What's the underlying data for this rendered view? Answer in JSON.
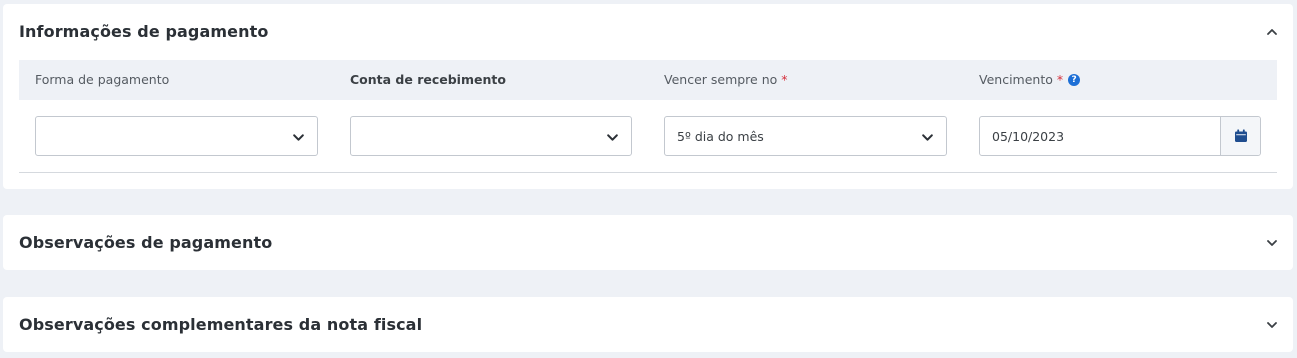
{
  "sections": {
    "payment_info": {
      "title": "Informações de pagamento",
      "labels": {
        "payment_method": "Forma de pagamento",
        "receiving_account": "Conta de recebimento",
        "due_rule": "Vencer sempre no",
        "due_date": "Vencimento"
      },
      "required_mark": "*",
      "help_glyph": "?",
      "fields": {
        "payment_method": "",
        "receiving_account": "",
        "due_rule": "5º dia do mês",
        "due_date": "05/10/2023"
      }
    },
    "payment_notes": {
      "title": "Observações de pagamento"
    },
    "invoice_notes": {
      "title": "Observações complementares da nota fiscal"
    }
  },
  "colors": {
    "background": "#eef1f6",
    "required": "#d4303c",
    "accent": "#1d6fd6",
    "calendar_icon": "#1f4d8f"
  },
  "icons": {
    "collapse": "chevron-up-icon",
    "expand": "chevron-down-icon",
    "dropdown": "chevron-down-icon",
    "help": "question-circle-icon",
    "calendar": "calendar-icon"
  }
}
